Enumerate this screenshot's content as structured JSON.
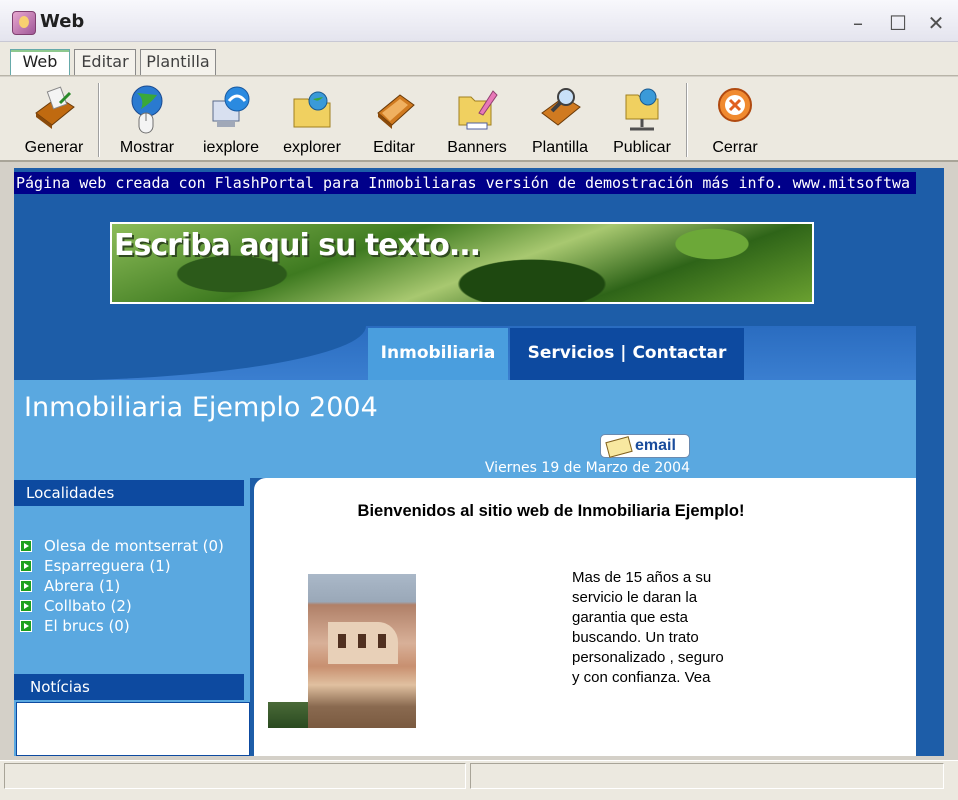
{
  "window": {
    "title": "Web",
    "minimize": "–",
    "maximize": "☐",
    "close": "✕"
  },
  "tabs": [
    "Web",
    "Editar",
    "Plantilla"
  ],
  "toolbar": {
    "buttons": [
      {
        "label": "Generar",
        "icon": "generate-icon"
      },
      {
        "label": "Mostrar",
        "icon": "globe-mouse-icon"
      },
      {
        "label": "iexplore",
        "icon": "internet-explorer-icon"
      },
      {
        "label": "explorer",
        "icon": "folder-globe-icon"
      },
      {
        "label": "Editar",
        "icon": "edit-book-icon"
      },
      {
        "label": "Banners",
        "icon": "banners-icon"
      },
      {
        "label": "Plantilla",
        "icon": "template-search-icon"
      },
      {
        "label": "Publicar",
        "icon": "publish-network-icon"
      },
      {
        "label": "Cerrar",
        "icon": "close-circle-icon"
      }
    ]
  },
  "web": {
    "marquee": "Página web creada con FlashPortal para Inmobiliaras versión de demostración más info. www.mitsoftwa",
    "banner_text": "Escriba aqui su texto...",
    "nav": {
      "tab1": "Inmobiliaria",
      "tab2": "Servicios | Contactar"
    },
    "site_title": "Inmobiliaria Ejemplo 2004",
    "email_label": "email",
    "date": "Viernes 19 de Marzo de 2004",
    "sidebar": {
      "localidades_header": "Localidades",
      "localidades": [
        "Olesa de montserrat (0)",
        "Esparreguera (1)",
        "Abrera (1)",
        "Collbato (2)",
        "El brucs (0)"
      ],
      "noticias_header": "Notícias"
    },
    "content": {
      "welcome": "Bienvenidos al sitio web de Inmobiliaria Ejemplo!",
      "body_text": "Mas de 15 años a su servicio le daran la garantia que esta buscando. Un trato personalizado , seguro y con confianza. Vea"
    }
  },
  "colors": {
    "page_bg": "#1d5da8",
    "header_light": "#5aa8e0",
    "tab_dark": "#0d4aa0",
    "marquee_bg": "#00008a"
  }
}
